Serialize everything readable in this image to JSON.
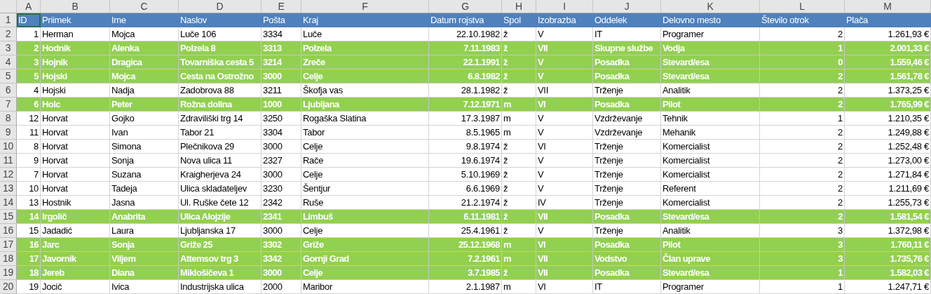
{
  "column_letters": [
    "A",
    "B",
    "C",
    "D",
    "E",
    "F",
    "G",
    "H",
    "I",
    "J",
    "K",
    "L",
    "M"
  ],
  "header_row": {
    "number": "1",
    "cells": [
      {
        "text": "ID",
        "selected": true
      },
      {
        "text": "Priimek",
        "selected": false
      },
      {
        "text": "Ime",
        "selected": false
      },
      {
        "text": "Naslov",
        "selected": false
      },
      {
        "text": "Pošta",
        "selected": false
      },
      {
        "text": "Kraj",
        "selected": false
      },
      {
        "text": "Datum rojstva",
        "selected": false
      },
      {
        "text": "Spol",
        "selected": false
      },
      {
        "text": "Izobrazba",
        "selected": false
      },
      {
        "text": "Oddelek",
        "selected": false
      },
      {
        "text": "Delovno mesto",
        "selected": false
      },
      {
        "text": "Število otrok",
        "selected": false
      },
      {
        "text": "Plača",
        "selected": false
      }
    ]
  },
  "rows": [
    {
      "number": "2",
      "highlighted": false,
      "cells": [
        "1",
        "Herman",
        "Mojca",
        "Luče 106",
        "3334",
        "Luče",
        "22.10.1982",
        "ž",
        "V",
        "IT",
        "Programer",
        "2",
        "1.261,93 €"
      ]
    },
    {
      "number": "3",
      "highlighted": true,
      "cells": [
        "2",
        "Hodnik",
        "Alenka",
        "Polzela 8",
        "3313",
        "Polzela",
        "7.11.1983",
        "ž",
        "VII",
        "Skupne službe",
        "Vodja",
        "1",
        "2.001,33 €"
      ]
    },
    {
      "number": "4",
      "highlighted": true,
      "cells": [
        "3",
        "Hojnik",
        "Dragica",
        "Tovarniška cesta 5",
        "3214",
        "Zreče",
        "22.1.1991",
        "ž",
        "V",
        "Posadka",
        "Stevard/esa",
        "0",
        "1.559,46 €"
      ]
    },
    {
      "number": "5",
      "highlighted": true,
      "cells": [
        "5",
        "Hojski",
        "Mojca",
        "Cesta na Ostrožno",
        "3000",
        "Celje",
        "6.8.1982",
        "ž",
        "V",
        "Posadka",
        "Stevard/esa",
        "2",
        "1.561,78 €"
      ]
    },
    {
      "number": "6",
      "highlighted": false,
      "cells": [
        "4",
        "Hojski",
        "Nadja",
        "Zadobrova 88",
        "3211",
        "Škofja vas",
        "28.1.1982",
        "ž",
        "VII",
        "Trženje",
        "Analitik",
        "2",
        "1.373,25 €"
      ]
    },
    {
      "number": "7",
      "highlighted": true,
      "cells": [
        "6",
        "Holc",
        "Peter",
        "Rožna dolina",
        "1000",
        "Ljubljana",
        "7.12.1971",
        "m",
        "VI",
        "Posadka",
        "Pilot",
        "2",
        "1.765,99 €"
      ]
    },
    {
      "number": "8",
      "highlighted": false,
      "cells": [
        "12",
        "Horvat",
        "Gojko",
        "Zdraviliški trg 14",
        "3250",
        "Rogaška Slatina",
        "17.3.1987",
        "m",
        "V",
        "Vzdrževanje",
        "Tehnik",
        "1",
        "1.210,35 €"
      ]
    },
    {
      "number": "9",
      "highlighted": false,
      "cells": [
        "11",
        "Horvat",
        "Ivan",
        "Tabor 21",
        "3304",
        "Tabor",
        "8.5.1965",
        "m",
        "V",
        "Vzdrževanje",
        "Mehanik",
        "2",
        "1.249,88 €"
      ]
    },
    {
      "number": "10",
      "highlighted": false,
      "cells": [
        "8",
        "Horvat",
        "Simona",
        "Plečnikova 29",
        "3000",
        "Celje",
        "9.8.1974",
        "ž",
        "VI",
        "Trženje",
        "Komercialist",
        "2",
        "1.252,48 €"
      ]
    },
    {
      "number": "11",
      "highlighted": false,
      "cells": [
        "9",
        "Horvat",
        "Sonja",
        "Nova ulica 11",
        "2327",
        "Rače",
        "19.6.1974",
        "ž",
        "V",
        "Trženje",
        "Komercialist",
        "2",
        "1.273,00 €"
      ]
    },
    {
      "number": "12",
      "highlighted": false,
      "cells": [
        "7",
        "Horvat",
        "Suzana",
        "Kraigherjeva 24",
        "3000",
        "Celje",
        "5.10.1969",
        "ž",
        "V",
        "Trženje",
        "Komercialist",
        "2",
        "1.271,84 €"
      ]
    },
    {
      "number": "13",
      "highlighted": false,
      "cells": [
        "10",
        "Horvat",
        "Tadeja",
        "Ulica skladateljev",
        "3230",
        "Šentjur",
        "6.6.1969",
        "ž",
        "V",
        "Trženje",
        "Referent",
        "2",
        "1.211,69 €"
      ]
    },
    {
      "number": "14",
      "highlighted": false,
      "cells": [
        "13",
        "Hostnik",
        "Jasna",
        "Ul. Ruške čete 12",
        "2342",
        "Ruše",
        "21.2.1974",
        "ž",
        "IV",
        "Trženje",
        "Komercialist",
        "2",
        "1.255,73 €"
      ]
    },
    {
      "number": "15",
      "highlighted": true,
      "cells": [
        "14",
        "Irgolič",
        "Anabrita",
        "Ulica Alojzije",
        "2341",
        "Limbuš",
        "6.11.1981",
        "ž",
        "VII",
        "Posadka",
        "Stevard/esa",
        "2",
        "1.581,54 €"
      ]
    },
    {
      "number": "16",
      "highlighted": false,
      "cells": [
        "15",
        "Jadadić",
        "Laura",
        "Ljubljanska 17",
        "3000",
        "Celje",
        "25.4.1961",
        "ž",
        "V",
        "Trženje",
        "Analitik",
        "3",
        "1.372,98 €"
      ]
    },
    {
      "number": "17",
      "highlighted": true,
      "cells": [
        "16",
        "Jarc",
        "Sonja",
        "Griže 25",
        "3302",
        "Griže",
        "25.12.1968",
        "m",
        "VI",
        "Posadka",
        "Pilot",
        "3",
        "1.760,11 €"
      ]
    },
    {
      "number": "18",
      "highlighted": true,
      "cells": [
        "17",
        "Javornik",
        "Viljem",
        "Attemsov trg 3",
        "3342",
        "Gornji Grad",
        "7.2.1961",
        "m",
        "VII",
        "Vodstvo",
        "Član uprave",
        "3",
        "1.735,76 €"
      ]
    },
    {
      "number": "19",
      "highlighted": true,
      "cells": [
        "18",
        "Jereb",
        "Diana",
        "Miklošičeva 1",
        "3000",
        "Celje",
        "3.7.1985",
        "ž",
        "VII",
        "Posadka",
        "Stevard/esa",
        "1",
        "1.582,03 €"
      ]
    },
    {
      "number": "20",
      "highlighted": false,
      "cells": [
        "19",
        "Jocič",
        "Ivica",
        "Industrijska ulica",
        "2000",
        "Maribor",
        "2.1.1987",
        "m",
        "VI",
        "IT",
        "Programer",
        "1",
        "1.247,71 €"
      ]
    }
  ]
}
